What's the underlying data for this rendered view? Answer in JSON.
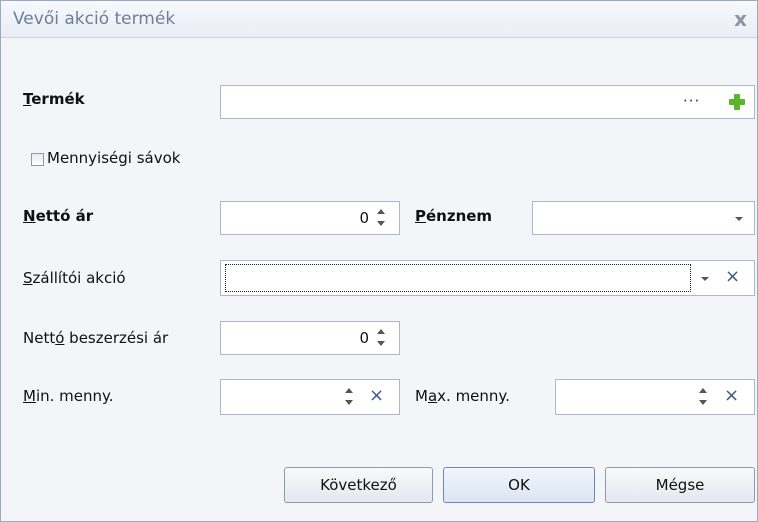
{
  "window": {
    "title": "Vevői akció termék",
    "close_glyph": "x"
  },
  "termek": {
    "label_u": "T",
    "label_rest": "ermék",
    "value": "",
    "ellipsis": "···"
  },
  "mennyisegi": {
    "label": "Mennyiségi sávok",
    "checked": false
  },
  "netto_ar": {
    "label_u": "N",
    "label_rest": "ettó ár",
    "value": "0"
  },
  "penznem": {
    "label_u": "P",
    "label_rest": "énznem",
    "value": ""
  },
  "szallitoi": {
    "label_u": "S",
    "label_rest": "zállítói akció",
    "value": ""
  },
  "beszerzesi": {
    "label_pre": "Nett",
    "label_u": "ó",
    "label_rest": " beszerzési ár",
    "value": "0"
  },
  "min": {
    "label_u": "M",
    "label_rest": "in. menny.",
    "value": ""
  },
  "max": {
    "label_pre": "M",
    "label_u": "a",
    "label_rest": "x. menny.",
    "value": ""
  },
  "buttons": {
    "next": "Következő",
    "ok": "OK",
    "cancel": "Mégse"
  },
  "icons": {
    "add": "plus-icon",
    "clear": "×"
  },
  "colors": {
    "add_green": "#5ab52c",
    "clear_blue": "#3d5a86"
  }
}
